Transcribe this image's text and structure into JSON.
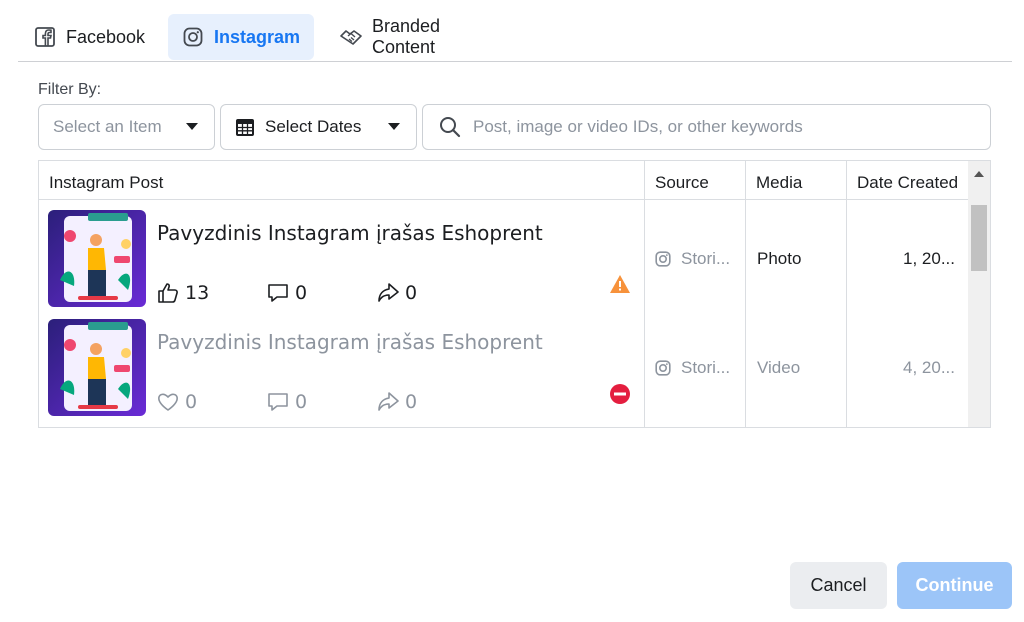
{
  "tabs": [
    {
      "label": "Facebook",
      "icon": "facebook-icon"
    },
    {
      "label": "Instagram",
      "icon": "instagram-icon",
      "active": true
    },
    {
      "label": "Branded Content",
      "icon": "handshake-icon"
    }
  ],
  "filter": {
    "label": "Filter By:",
    "item_placeholder": "Select an Item",
    "dates_label": "Select Dates",
    "search_placeholder": "Post, image or video IDs, or other keywords"
  },
  "table": {
    "columns": [
      "Instagram Post",
      "Source",
      "Media",
      "Date Created"
    ],
    "rows": [
      {
        "title": "Pavyzdinis Instagram įrašas Eshoprent",
        "likes": "13",
        "comments": "0",
        "shares": "0",
        "status": "warning",
        "source": "Stori...",
        "media": "Photo",
        "date": "1, 20...",
        "dimmed": false
      },
      {
        "title": "Pavyzdinis Instagram įrašas Eshoprent",
        "likes": "0",
        "comments": "0",
        "shares": "0",
        "status": "blocked",
        "source": "Stori...",
        "media": "Video",
        "date": "4, 20...",
        "dimmed": true
      }
    ]
  },
  "footer": {
    "cancel_label": "Cancel",
    "continue_label": "Continue"
  },
  "colors": {
    "accent": "#1877f2",
    "warning": "#f7923b",
    "error": "#e41e3f",
    "continue_disabled": "#9cc5f8"
  }
}
